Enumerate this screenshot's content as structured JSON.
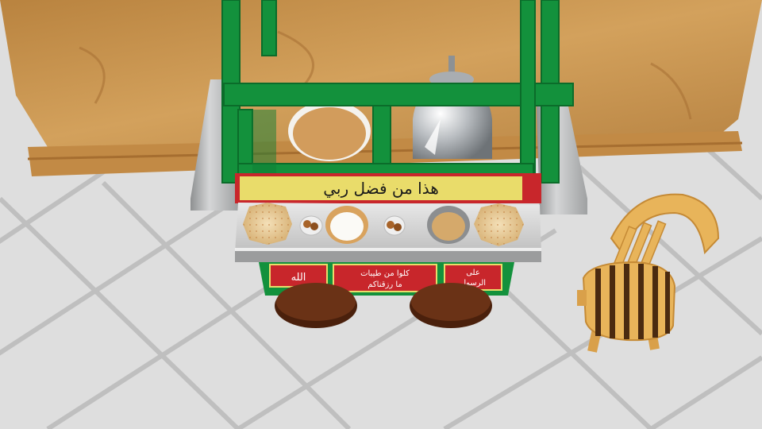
{
  "scene": {
    "type": "3d-game-view",
    "colors": {
      "floor": "#dcdcdc",
      "floor_seam": "#b9b9b9",
      "table_wood": "#c7924f",
      "cart_green": "#13913c",
      "cart_red": "#c8262b",
      "sign_yellow": "#e9dc6a",
      "metal": "#b9babb",
      "wheel": "#5a2a12",
      "chair_wood": "#e8b45a",
      "chair_stripe": "#4a2a10"
    }
  },
  "cart": {
    "top_sign": "هذا من فضل ربي",
    "panel_left": "الله",
    "panel_center_line1": "كلوا من طيبات",
    "panel_center_line2": "ما رزقناكم",
    "panel_right_line1": "على",
    "panel_right_line2": "الرسول",
    "food_items": [
      "flatbread",
      "falafel",
      "dip-bowl",
      "falafel",
      "hummus-bowl",
      "flatbread"
    ]
  },
  "chair": {
    "icon": "wooden-chair"
  },
  "table": {
    "icon": "wooden-table"
  },
  "urn": {
    "icon": "metal-tea-urn"
  }
}
